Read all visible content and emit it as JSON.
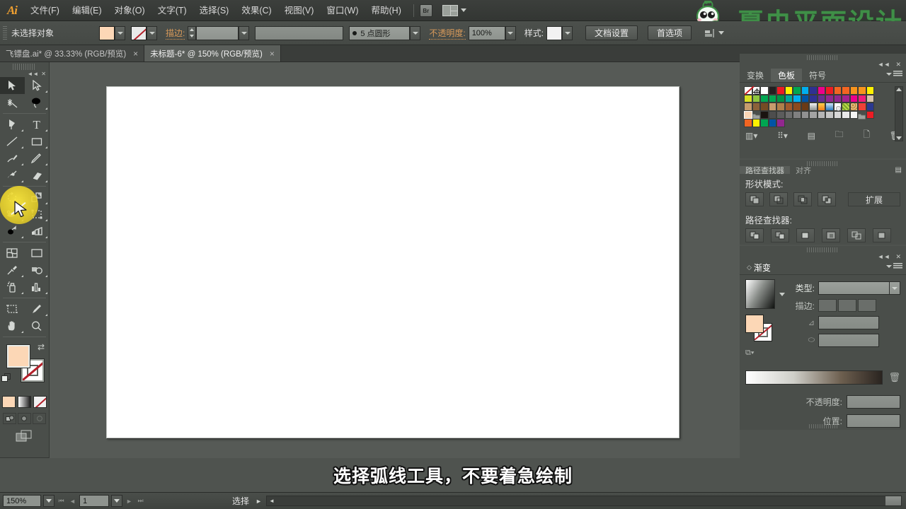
{
  "app": {
    "logo": "Ai",
    "watermark_text": "夏虫平面设计"
  },
  "menubar": {
    "items": [
      {
        "label": "文件(F)",
        "name": "menu-file"
      },
      {
        "label": "编辑(E)",
        "name": "menu-edit"
      },
      {
        "label": "对象(O)",
        "name": "menu-object"
      },
      {
        "label": "文字(T)",
        "name": "menu-type"
      },
      {
        "label": "选择(S)",
        "name": "menu-select"
      },
      {
        "label": "效果(C)",
        "name": "menu-effect"
      },
      {
        "label": "视图(V)",
        "name": "menu-view"
      },
      {
        "label": "窗口(W)",
        "name": "menu-window"
      },
      {
        "label": "帮助(H)",
        "name": "menu-help"
      }
    ],
    "bridge_label": "Br"
  },
  "options_bar": {
    "selection_status": "未选择对象",
    "stroke_label": "描边:",
    "stroke_weight": "",
    "stroke_profile": "",
    "brush_definition": "5 点圆形",
    "opacity_label": "不透明度:",
    "opacity_value": "100%",
    "style_label": "样式:",
    "document_setup": "文档设置",
    "preferences": "首选项"
  },
  "tabs": [
    {
      "label": "飞镖盘.ai* @ 33.33% (RGB/预览)",
      "active": false,
      "close": "×"
    },
    {
      "label": "未标题-6* @ 150% (RGB/预览)",
      "active": true,
      "close": "×"
    }
  ],
  "toolbar": {
    "tools": [
      {
        "name": "selection-tool",
        "icon": "arrow-solid",
        "selected": true
      },
      {
        "name": "direct-selection-tool",
        "icon": "arrow-hollow",
        "selected": false
      },
      {
        "name": "magic-wand-tool",
        "icon": "magic-wand",
        "selected": false
      },
      {
        "name": "lasso-tool",
        "icon": "lasso",
        "selected": false
      },
      {
        "name": "pen-tool",
        "icon": "pen",
        "selected": false
      },
      {
        "name": "type-tool",
        "icon": "type-T",
        "selected": false
      },
      {
        "name": "line-segment-tool",
        "icon": "line-diagonal",
        "selected": false
      },
      {
        "name": "rectangle-tool",
        "icon": "rectangle",
        "selected": false
      },
      {
        "name": "paintbrush-tool",
        "icon": "paintbrush",
        "selected": false
      },
      {
        "name": "pencil-tool",
        "icon": "pencil",
        "selected": false
      },
      {
        "name": "blob-brush-tool",
        "icon": "blob-brush",
        "selected": false
      },
      {
        "name": "eraser-tool",
        "icon": "eraser",
        "selected": false
      },
      {
        "name": "rotate-tool",
        "icon": "rotate",
        "selected": false
      },
      {
        "name": "scale-tool",
        "icon": "scale",
        "selected": false
      },
      {
        "name": "width-tool",
        "icon": "width",
        "selected": false
      },
      {
        "name": "free-transform-tool",
        "icon": "free-transform",
        "selected": false
      },
      {
        "name": "shape-builder-tool",
        "icon": "shape-builder",
        "selected": false
      },
      {
        "name": "perspective-grid-tool",
        "icon": "perspective-grid",
        "selected": false
      },
      {
        "name": "mesh-tool",
        "icon": "mesh",
        "selected": false
      },
      {
        "name": "gradient-tool",
        "icon": "gradient",
        "selected": false
      },
      {
        "name": "eyedropper-tool",
        "icon": "eyedropper",
        "selected": false
      },
      {
        "name": "blend-tool",
        "icon": "blend",
        "selected": false
      },
      {
        "name": "symbol-sprayer-tool",
        "icon": "symbol-sprayer",
        "selected": false
      },
      {
        "name": "column-graph-tool",
        "icon": "column-graph",
        "selected": false
      },
      {
        "name": "artboard-tool",
        "icon": "artboard",
        "selected": false
      },
      {
        "name": "slice-tool",
        "icon": "slice",
        "selected": false
      },
      {
        "name": "hand-tool",
        "icon": "hand",
        "selected": false
      },
      {
        "name": "zoom-tool",
        "icon": "magnifier",
        "selected": false
      }
    ],
    "fill_color": "#fcd7b6",
    "stroke_color": "none"
  },
  "highlight": {
    "target_tool": "line-segment-tool",
    "color": "#f2e03c"
  },
  "panels": {
    "swatches": {
      "tabs": [
        {
          "label": "变换",
          "active": false
        },
        {
          "label": "色板",
          "active": true
        },
        {
          "label": "符号",
          "active": false
        }
      ],
      "rows": [
        [
          "none",
          "registration",
          "#ffffff",
          "#231f20",
          "#ed1c24",
          "#fff200",
          "#00a651",
          "#00aeef",
          "#2e3192",
          "#ec008c",
          "#ed1c24",
          "#f26522",
          "#f26522",
          "#f7941d"
        ],
        [
          "#f7941d",
          "#fff200",
          "#d7df23",
          "#8dc63f",
          "#00a651",
          "#00a651",
          "#009444",
          "#00a79d",
          "#00aeef",
          "#0054a6",
          "#2e3192",
          "#662d91",
          "#92278f"
        ],
        [
          "#92278f",
          "#a3238e",
          "#ec008c",
          "#ed1e79",
          "#d9c3a9",
          "#c69c6d",
          "#8c6239",
          "#754c24",
          "#c69c6d",
          "#b07f4a",
          "#a05a2c",
          "#8c4a1e",
          "#6b3a16"
        ],
        [
          "gradient-gray",
          "gradient-orange",
          "gradient-blue",
          "pattern-dot",
          "pattern-green",
          "pattern-leopard",
          "#ef4136",
          "#2b3990",
          "#fcd7b6"
        ],
        [
          "folder",
          "#1a1410",
          "#4d4d4d",
          "#5c5c5c",
          "#6e6e6e",
          "#808080",
          "#919191",
          "#a3a3a3",
          "#b5b5b5",
          "#c6c6c6",
          "#d8d8d8",
          "#e9e9e9",
          "#f5f5f5"
        ],
        [
          "folder",
          "#ed1c24",
          "#f26522",
          "#fff200",
          "#00a651",
          "#0054a6",
          "#92278f"
        ]
      ],
      "selected_index": "row4-col9",
      "footer_icons": [
        "swatch-libraries-icon",
        "show-swatch-kinds-icon",
        "swatch-options-icon",
        "new-color-group-icon",
        "new-swatch-icon",
        "delete-swatch-icon"
      ]
    },
    "pathfinder": {
      "shape_modes_label": "形状模式:",
      "expand_label": "扩展",
      "pathfinders_label": "路径查找器:",
      "shape_mode_buttons": [
        "unite",
        "minus-front",
        "intersect",
        "exclude"
      ],
      "pathfinder_buttons": [
        "divide",
        "trim",
        "merge",
        "crop",
        "outline",
        "minus-back"
      ]
    },
    "gradient": {
      "title": "渐变",
      "type_label": "类型:",
      "type_value": "",
      "stroke_label": "描边:",
      "angle_label": "",
      "angle_value": "",
      "aspect_label": "",
      "aspect_value": "",
      "opacity_label": "不透明度:",
      "opacity_value": "",
      "location_label": "位置:",
      "location_value": ""
    }
  },
  "subtitle": {
    "text": "选择弧线工具，不要着急绘制"
  },
  "statusbar": {
    "zoom": "150%",
    "page": "1",
    "status_text": "选择"
  }
}
